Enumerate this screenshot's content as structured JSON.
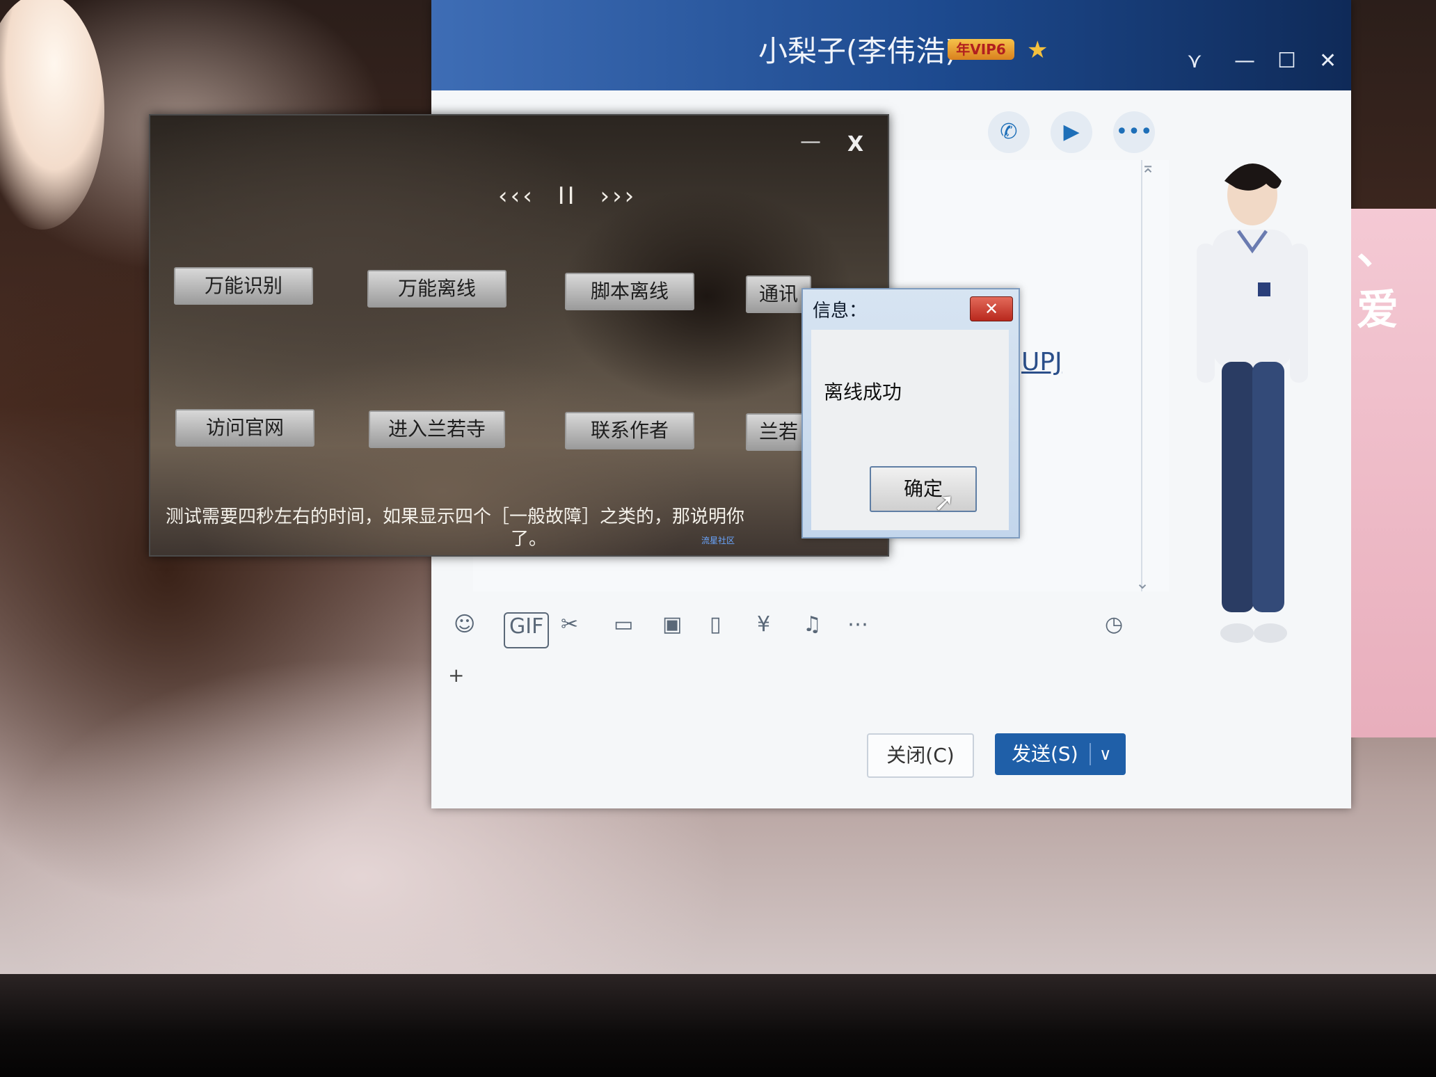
{
  "qq_window": {
    "title": "小梨子(李伟浩)",
    "vip_badge": "年VIP6",
    "window_controls": {
      "dropdown": "⋎",
      "minimize": "—",
      "maximize": "☐",
      "close": "✕"
    },
    "actions": {
      "call": "✆",
      "video": "▶",
      "more": "•••"
    },
    "chat_link_text": "UPJ",
    "toolbar": {
      "emoji": "☺",
      "gif": "GIF",
      "screenshot": "✂",
      "folder": "▭",
      "image": "▣",
      "shake": "▯",
      "redpacket": "¥",
      "music": "♫",
      "more": "⋯",
      "history": "◷"
    },
    "input_cursor": "+",
    "close_label": "关闭(C)",
    "send_label": "发送(S)",
    "send_dropdown": "∨"
  },
  "side_widget": {
    "text": "、爱"
  },
  "tool_window": {
    "minimize": "—",
    "close": "X",
    "player": {
      "prev": "‹‹‹",
      "pause": "II",
      "next": "›››"
    },
    "buttons_row1": [
      "万能识别",
      "万能离线",
      "脚本离线",
      "通讯"
    ],
    "buttons_row2": [
      "访问官网",
      "进入兰若寺",
      "联系作者",
      "兰若"
    ],
    "note_line1": "测试需要四秒左右的时间，如果显示四个［一般故障］之类的，那说明你",
    "note_line2": "了。",
    "small_label": "流星社区"
  },
  "message_box": {
    "title": "信息：",
    "close": "✕",
    "message": "离线成功",
    "ok_label": "确定"
  }
}
